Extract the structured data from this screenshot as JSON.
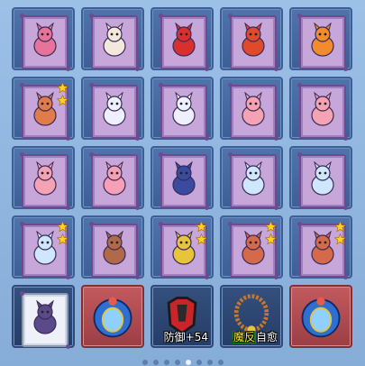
{
  "grid": {
    "slots": [
      {
        "kind": "pet",
        "variant": "purple",
        "icon": "pink-fox-pet-icon",
        "color": "#e8739a",
        "stars": 0
      },
      {
        "kind": "pet",
        "variant": "purple",
        "icon": "white-deer-pet-icon",
        "color": "#f2e9dc",
        "stars": 0
      },
      {
        "kind": "pet",
        "variant": "purple",
        "icon": "red-lion-dance-pet-icon",
        "color": "#d8302f",
        "stars": 0
      },
      {
        "kind": "pet",
        "variant": "purple",
        "icon": "red-lion-dance-pet-icon",
        "color": "#e04a2c",
        "stars": 0
      },
      {
        "kind": "pet",
        "variant": "purple",
        "icon": "orange-lion-dance-pet-icon",
        "color": "#f28a2e",
        "stars": 0
      },
      {
        "kind": "pet",
        "variant": "purple",
        "icon": "fox-warrior-pet-icon",
        "color": "#e07b4a",
        "stars": 2
      },
      {
        "kind": "pet",
        "variant": "purple",
        "icon": "white-unicorn-pet-icon",
        "color": "#eef0ff",
        "stars": 0
      },
      {
        "kind": "pet",
        "variant": "purple",
        "icon": "white-unicorn-pet-icon",
        "color": "#eef0ff",
        "stars": 0
      },
      {
        "kind": "pet",
        "variant": "purple",
        "icon": "pink-pig-pet-icon",
        "color": "#f4a3b4",
        "stars": 0
      },
      {
        "kind": "pet",
        "variant": "purple",
        "icon": "pink-pig-pet-icon",
        "color": "#f4a3b4",
        "stars": 0
      },
      {
        "kind": "pet",
        "variant": "purple",
        "icon": "pink-pig-pet-icon",
        "color": "#f4a3b4",
        "stars": 0
      },
      {
        "kind": "pet",
        "variant": "purple",
        "icon": "pink-bird-pet-icon",
        "color": "#f5a0b6",
        "stars": 0
      },
      {
        "kind": "pet",
        "variant": "purple",
        "icon": "blue-knight-pet-icon",
        "color": "#3a4a9e",
        "stars": 0
      },
      {
        "kind": "pet",
        "variant": "purple",
        "icon": "ice-fox-pet-icon",
        "color": "#cfe6ff",
        "stars": 0
      },
      {
        "kind": "pet",
        "variant": "purple",
        "icon": "ice-fox-pet-icon",
        "color": "#cfe6ff",
        "stars": 0
      },
      {
        "kind": "pet",
        "variant": "purple",
        "icon": "ice-fox-pet-icon",
        "color": "#cfe6ff",
        "stars": 2
      },
      {
        "kind": "pet",
        "variant": "purple",
        "icon": "brown-boar-pet-icon",
        "color": "#b06a4a",
        "stars": 0
      },
      {
        "kind": "pet",
        "variant": "purple",
        "icon": "golden-knight-pet-icon",
        "color": "#e8c43a",
        "stars": 2
      },
      {
        "kind": "pet",
        "variant": "purple",
        "icon": "fox-warrior-pet-icon",
        "color": "#d46a4a",
        "stars": 2
      },
      {
        "kind": "pet",
        "variant": "purple",
        "icon": "fox-warrior-pet-icon",
        "color": "#d46a4a",
        "stars": 2
      },
      {
        "kind": "pet",
        "variant": "white",
        "slot": "dark",
        "icon": "shadow-wolf-pet-icon",
        "color": "#5a4a8a",
        "stars": 0
      },
      {
        "kind": "item",
        "slot": "red",
        "icon": "blue-spirit-mask-item-icon",
        "color": "#2f6fd0",
        "stars": 0
      },
      {
        "kind": "item",
        "slot": "dark",
        "icon": "red-armor-item-icon",
        "color": "#c8242a",
        "stars": 0,
        "badge": "防御+54"
      },
      {
        "kind": "item",
        "slot": "dark",
        "icon": "bead-necklace-item-icon",
        "color": "#c8782a",
        "stars": 0,
        "badge_hl": "魔反",
        "badge_rest": "自愈"
      },
      {
        "kind": "item",
        "slot": "red",
        "icon": "blue-spirit-mask-item-icon",
        "color": "#2f6fd0",
        "stars": 0
      }
    ]
  },
  "pager": {
    "count": 8,
    "active": 4
  }
}
